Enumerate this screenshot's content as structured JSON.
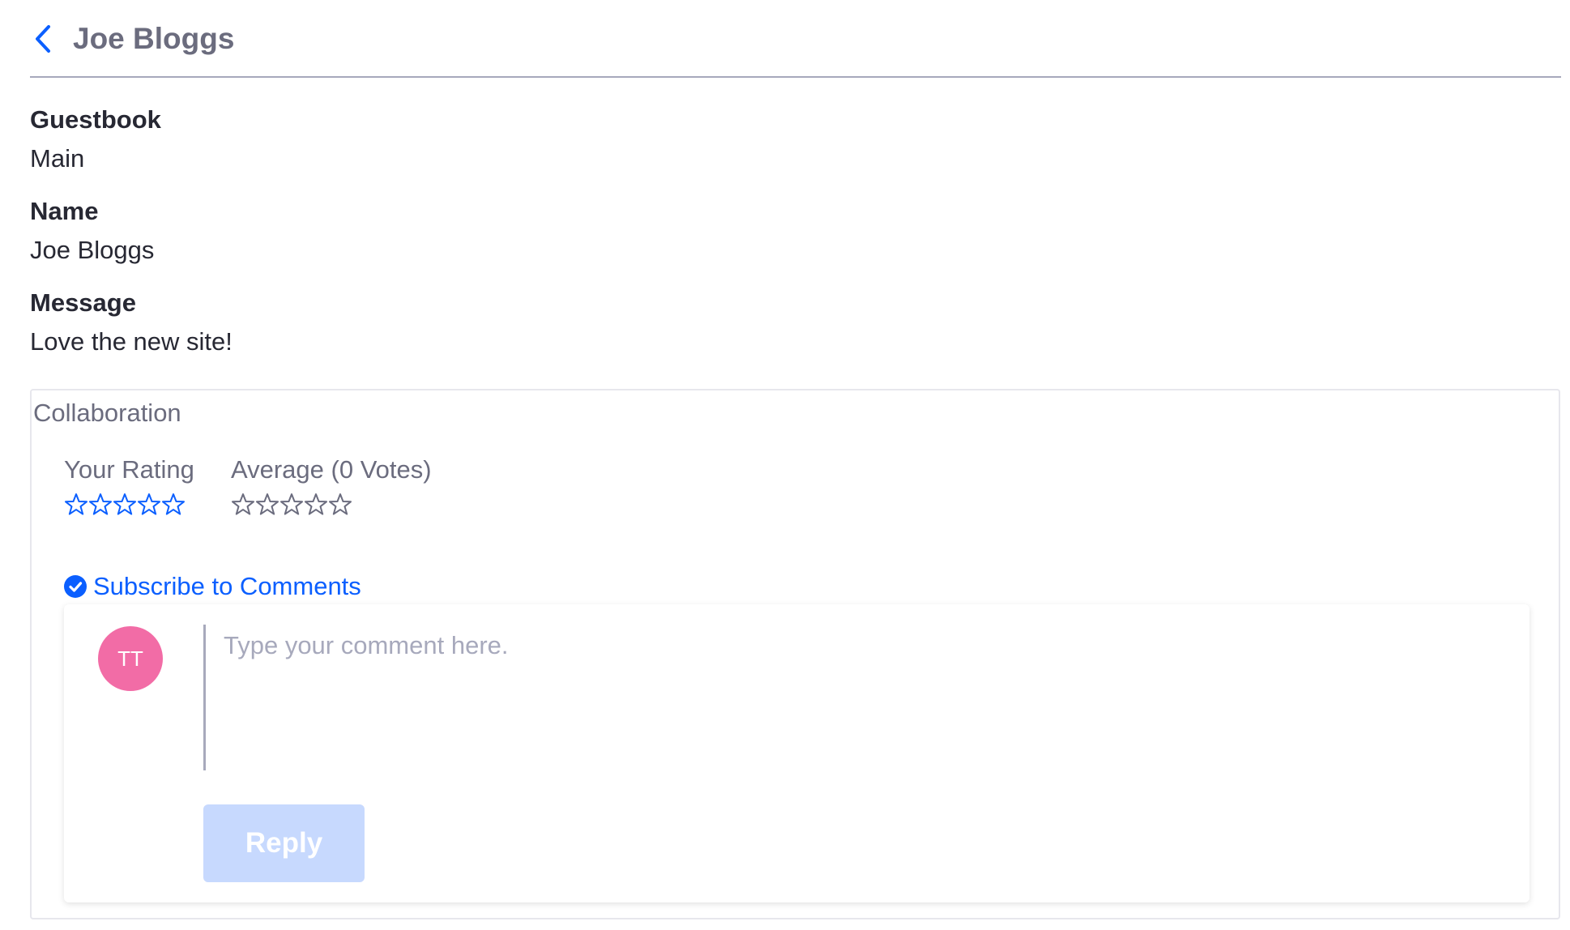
{
  "header": {
    "back_icon": "chevron-left-icon",
    "title": "Joe Bloggs"
  },
  "fields": [
    {
      "label": "Guestbook",
      "value": "Main"
    },
    {
      "label": "Name",
      "value": "Joe Bloggs"
    },
    {
      "label": "Message",
      "value": "Love the new site!"
    }
  ],
  "collaboration": {
    "legend": "Collaboration",
    "your_rating": {
      "label": "Your Rating",
      "stars_total": 5,
      "stars_filled": 0
    },
    "average": {
      "label": "Average (0 Votes)",
      "stars_total": 5,
      "stars_filled": 0
    },
    "subscribe": {
      "icon": "check-circle-icon",
      "label": "Subscribe to Comments"
    },
    "comment": {
      "avatar_initials": "TT",
      "placeholder": "Type your comment here.",
      "reply_label": "Reply"
    }
  },
  "colors": {
    "accent": "#0b5fff",
    "avatar": "#f26ca6",
    "reply_disabled": "#c7d9fe",
    "muted_text": "#6b6c7e"
  }
}
